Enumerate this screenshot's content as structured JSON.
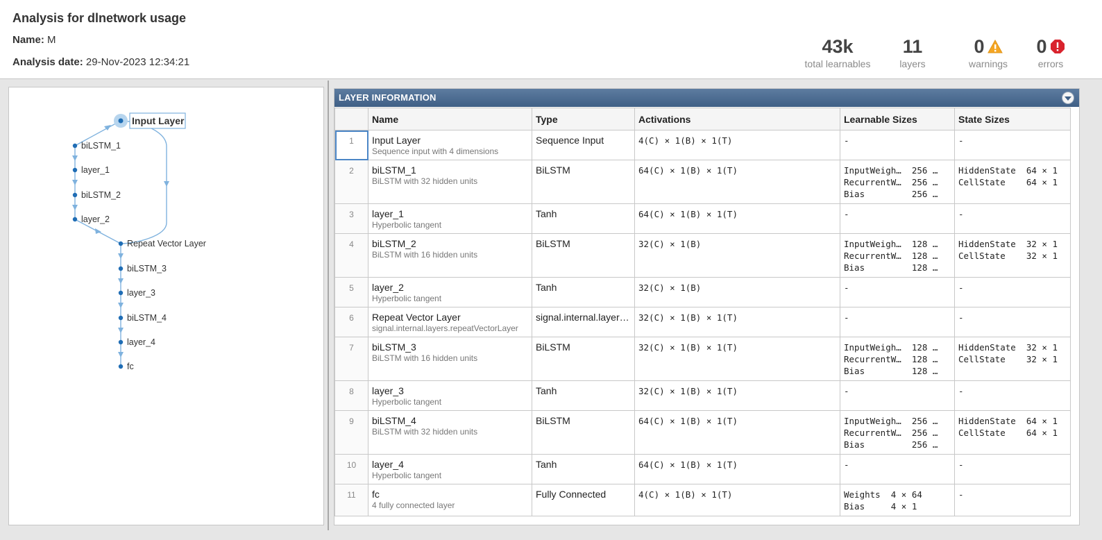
{
  "header": {
    "title": "Analysis for dlnetwork usage",
    "name_label": "Name:",
    "name_value": "M",
    "date_label": "Analysis date:",
    "date_value": "29-Nov-2023 12:34:21",
    "stats": {
      "learnables": {
        "value": "43k",
        "label": "total learnables"
      },
      "layers": {
        "value": "11",
        "label": "layers"
      },
      "warnings": {
        "value": "0",
        "label": "warnings"
      },
      "errors": {
        "value": "0",
        "label": "errors"
      }
    }
  },
  "graph": {
    "nodes": [
      "Input Layer",
      "biLSTM_1",
      "layer_1",
      "biLSTM_2",
      "layer_2",
      "Repeat Vector Layer",
      "biLSTM_3",
      "layer_3",
      "biLSTM_4",
      "layer_4",
      "fc"
    ]
  },
  "panel": {
    "title": "LAYER INFORMATION",
    "columns": [
      "Name",
      "Type",
      "Activations",
      "Learnable Sizes",
      "State Sizes"
    ]
  },
  "rows": [
    {
      "idx": "1",
      "name": "Input Layer",
      "desc": "Sequence input with 4 dimensions",
      "type": "Sequence Input",
      "act": "4(C) × 1(B) × 1(T)",
      "learn": "-",
      "state": "-"
    },
    {
      "idx": "2",
      "name": "biLSTM_1",
      "desc": "BiLSTM with 32 hidden units",
      "type": "BiLSTM",
      "act": "64(C) × 1(B) × 1(T)",
      "learn": "InputWeigh…  256 …\nRecurrentW…  256 …\nBias         256 …",
      "state": "HiddenState  64 × 1\nCellState    64 × 1"
    },
    {
      "idx": "3",
      "name": "layer_1",
      "desc": "Hyperbolic tangent",
      "type": "Tanh",
      "act": "64(C) × 1(B) × 1(T)",
      "learn": "-",
      "state": "-"
    },
    {
      "idx": "4",
      "name": "biLSTM_2",
      "desc": "BiLSTM with 16 hidden units",
      "type": "BiLSTM",
      "act": "32(C) × 1(B)",
      "learn": "InputWeigh…  128 …\nRecurrentW…  128 …\nBias         128 …",
      "state": "HiddenState  32 × 1\nCellState    32 × 1"
    },
    {
      "idx": "5",
      "name": "layer_2",
      "desc": "Hyperbolic tangent",
      "type": "Tanh",
      "act": "32(C) × 1(B)",
      "learn": "-",
      "state": "-"
    },
    {
      "idx": "6",
      "name": "Repeat Vector Layer",
      "desc": "signal.internal.layers.repeatVectorLayer",
      "type": "signal.internal.layers....",
      "act": "32(C) × 1(B) × 1(T)",
      "learn": "-",
      "state": "-"
    },
    {
      "idx": "7",
      "name": "biLSTM_3",
      "desc": "BiLSTM with 16 hidden units",
      "type": "BiLSTM",
      "act": "32(C) × 1(B) × 1(T)",
      "learn": "InputWeigh…  128 …\nRecurrentW…  128 …\nBias         128 …",
      "state": "HiddenState  32 × 1\nCellState    32 × 1"
    },
    {
      "idx": "8",
      "name": "layer_3",
      "desc": "Hyperbolic tangent",
      "type": "Tanh",
      "act": "32(C) × 1(B) × 1(T)",
      "learn": "-",
      "state": "-"
    },
    {
      "idx": "9",
      "name": "biLSTM_4",
      "desc": "BiLSTM with 32 hidden units",
      "type": "BiLSTM",
      "act": "64(C) × 1(B) × 1(T)",
      "learn": "InputWeigh…  256 …\nRecurrentW…  256 …\nBias         256 …",
      "state": "HiddenState  64 × 1\nCellState    64 × 1"
    },
    {
      "idx": "10",
      "name": "layer_4",
      "desc": "Hyperbolic tangent",
      "type": "Tanh",
      "act": "64(C) × 1(B) × 1(T)",
      "learn": "-",
      "state": "-"
    },
    {
      "idx": "11",
      "name": "fc",
      "desc": "4 fully connected layer",
      "type": "Fully Connected",
      "act": "4(C) × 1(B) × 1(T)",
      "learn": "Weights  4 × 64\nBias     4 × 1",
      "state": "-"
    }
  ],
  "colors": {
    "accent": "#4b86c6",
    "warning": "#f5a623",
    "error": "#d9232d",
    "header_bar": "#4a6a90"
  }
}
